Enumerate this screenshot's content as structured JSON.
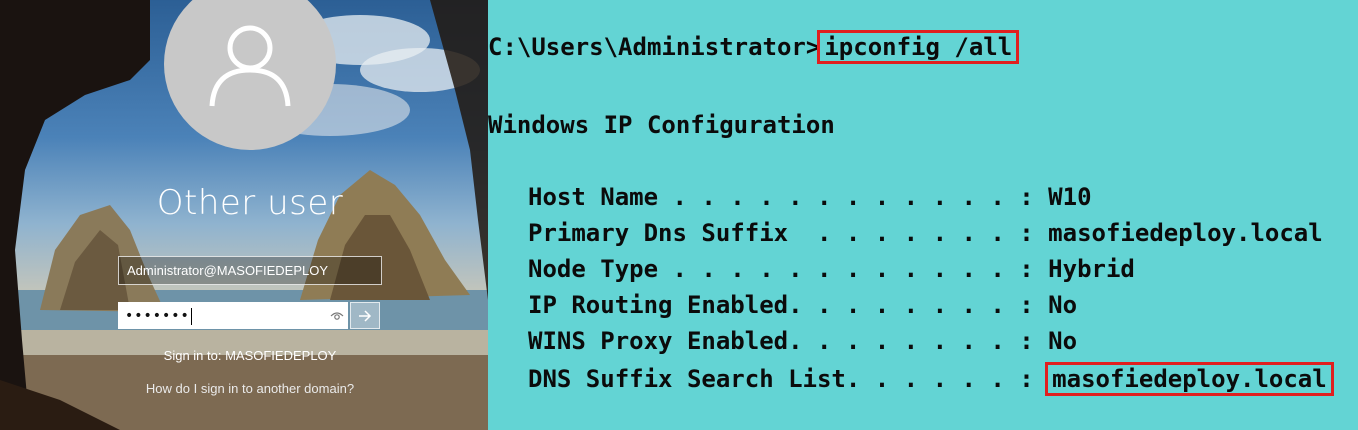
{
  "login": {
    "user_title": "Other user",
    "username_value": "Administrator@MASOFIEDEPLOY",
    "password_mask": "•••••••",
    "sign_in_to": "Sign in to: MASOFIEDEPLOY",
    "other_domain_link": "How do I sign in to another domain?"
  },
  "console": {
    "prompt": "C:\\Users\\Administrator>",
    "command": "ipconfig /all",
    "heading": "Windows IP Configuration",
    "rows": [
      {
        "label": "Host Name . . . . . . . . . . . . : ",
        "value": "W10"
      },
      {
        "label": "Primary Dns Suffix  . . . . . . . : ",
        "value": "masofiedeploy.local"
      },
      {
        "label": "Node Type . . . . . . . . . . . . : ",
        "value": "Hybrid"
      },
      {
        "label": "IP Routing Enabled. . . . . . . . : ",
        "value": "No"
      },
      {
        "label": "WINS Proxy Enabled. . . . . . . . : ",
        "value": "No"
      },
      {
        "label": "DNS Suffix Search List. . . . . . : ",
        "value": "masofiedeploy.local"
      }
    ],
    "highlight_color": "#e01f1f",
    "background_color": "#63d4d4"
  }
}
